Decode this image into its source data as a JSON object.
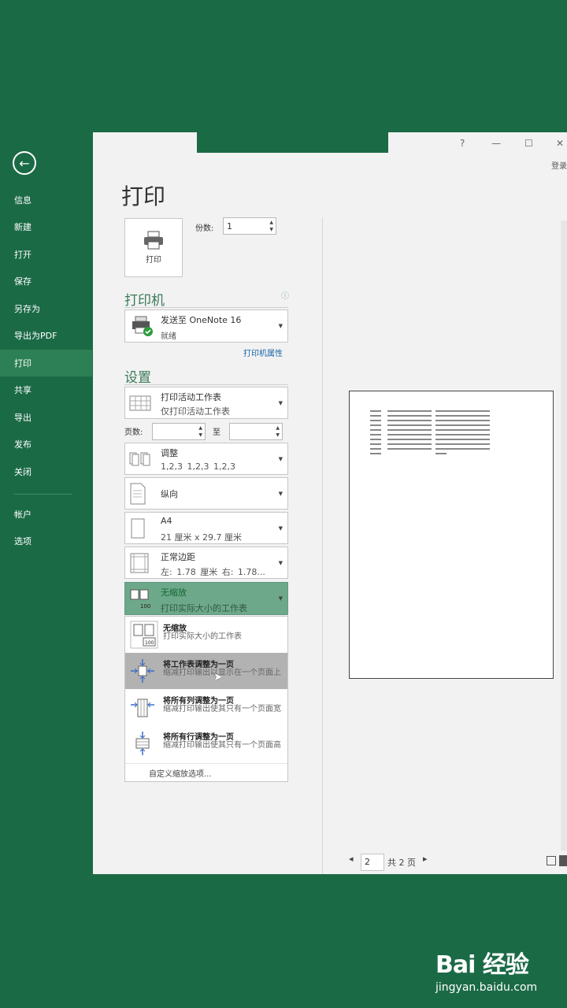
{
  "nav": {
    "back_icon": "arrow-left-icon",
    "items": [
      "信息",
      "新建",
      "打开",
      "保存",
      "另存为",
      "导出为PDF",
      "打印",
      "共享",
      "导出",
      "发布",
      "关闭"
    ],
    "items2": [
      "帐户",
      "选项"
    ],
    "active": "打印"
  },
  "window": {
    "help": "?",
    "minimize": "—",
    "maximize": "☐",
    "close": "✕",
    "login": "登录"
  },
  "print": {
    "title": "打印",
    "print_button": "打印",
    "copies_label": "份数:",
    "copies_value": "1"
  },
  "printer": {
    "section": "打印机",
    "info_icon": "ⓘ",
    "name": "发送至 OneNote 16",
    "status": "就绪",
    "properties_link": "打印机属性"
  },
  "settings": {
    "section": "设置",
    "what": {
      "line1": "打印活动工作表",
      "line2": "仅打印活动工作表"
    },
    "pages_label": "页数:",
    "to_label": "至",
    "collate": {
      "line1": "调整",
      "line2": "1,2,3    1,2,3    1,2,3"
    },
    "orientation": {
      "line1": "纵向"
    },
    "paper": {
      "line1": "A4",
      "line2": "21 厘米 x 29.7 厘米"
    },
    "margins": {
      "line1": "正常边距",
      "line2": "左: 1.78 厘米    右: 1.78..."
    },
    "scaling": {
      "line1": "无缩放",
      "line2": "打印实际大小的工作表"
    }
  },
  "scaling_menu": {
    "items": [
      {
        "title": "无缩放",
        "desc": "打印实际大小的工作表"
      },
      {
        "title": "将工作表调整为一页",
        "desc": "缩减打印输出以显示在一个页面上"
      },
      {
        "title": "将所有列调整为一页",
        "desc": "缩减打印输出使其只有一个页面宽"
      },
      {
        "title": "将所有行调整为一页",
        "desc": "缩减打印输出使其只有一个页面高"
      }
    ],
    "custom": "自定义缩放选项..."
  },
  "preview": {
    "current_page": "2",
    "total_pages": "共 2 页",
    "prev_icon": "◂",
    "next_icon": "▸"
  },
  "watermark": {
    "brand": "Bai 经验",
    "url": "jingyan.baidu.com"
  }
}
